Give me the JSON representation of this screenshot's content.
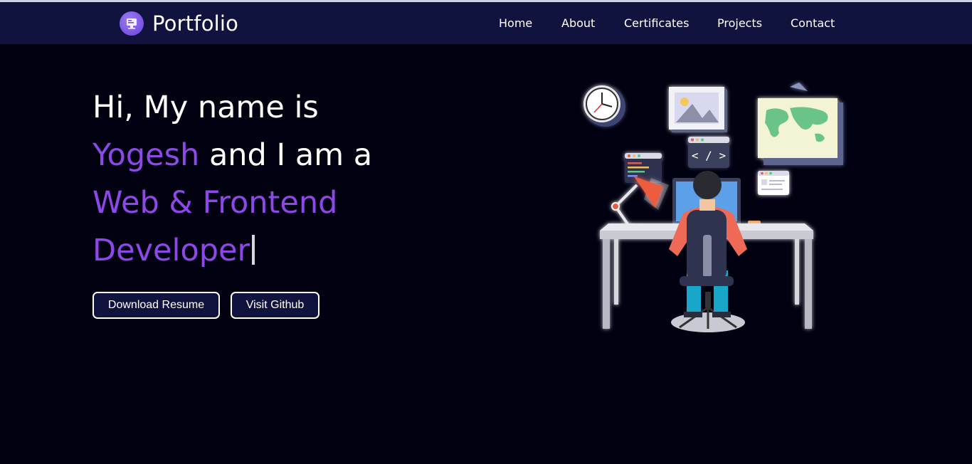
{
  "navbar": {
    "brand": "Portfolio",
    "links": [
      "Home",
      "About",
      "Certificates",
      "Projects",
      "Contact"
    ]
  },
  "hero": {
    "line1": "Hi, My name is",
    "name": "Yogesh",
    "line2_rest": " and I am a",
    "line3": "Web & Frontend",
    "line4": "Developer",
    "buttons": {
      "download": "Download Resume",
      "github": "Visit Github"
    }
  },
  "illustration": {
    "code_tag": "< / >"
  },
  "colors": {
    "navbar_bg": "#11133f",
    "page_bg": "#020112",
    "accent": "#8e48e8"
  }
}
